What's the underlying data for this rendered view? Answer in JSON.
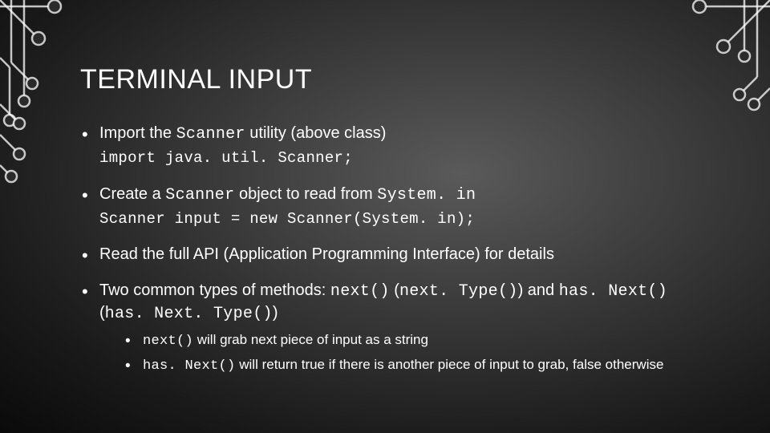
{
  "title": "TERMINAL INPUT",
  "bullets": [
    {
      "pre1": "Import the ",
      "code1": "Scanner",
      "post1": " utility (above class)",
      "codeLine": "import java. util. Scanner;"
    },
    {
      "pre1": "Create a ",
      "code1": "Scanner",
      "mid1": " object to read from ",
      "code2": "System. in",
      "codeLine": "Scanner input = new Scanner(System. in);"
    },
    {
      "text": "Read the full API (Application Programming Interface) for details"
    },
    {
      "pre1": "Two common types of methods: ",
      "code1": "next()",
      "mid1": " (",
      "code2": "next. Type()",
      "mid2": ") and ",
      "code3": "has. Next()",
      "mid3": " (",
      "code4": "has. Next. Type()",
      "post1": ")",
      "sub": [
        {
          "code": "next()",
          "text": "  will grab next piece of input as a string"
        },
        {
          "code": "has. Next()",
          "text": "  will return true if there is another piece of input to grab, false otherwise"
        }
      ]
    }
  ]
}
